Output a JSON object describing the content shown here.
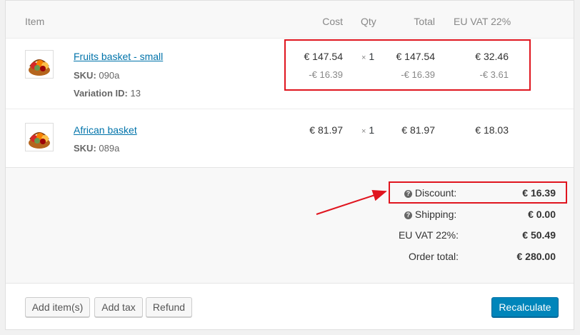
{
  "table": {
    "headers": {
      "item": "Item",
      "cost": "Cost",
      "qty": "Qty",
      "total": "Total",
      "tax": "EU VAT 22%"
    }
  },
  "items": [
    {
      "name": "Fruits basket - small",
      "sku_label": "SKU:",
      "sku": "090a",
      "variation_label": "Variation ID:",
      "variation": "13",
      "cost": "€ 147.54",
      "cost_discount": "-€ 16.39",
      "qty_sign": "×",
      "qty": "1",
      "total": "€ 147.54",
      "total_discount": "-€ 16.39",
      "tax": "€ 32.46",
      "tax_discount": "-€ 3.61",
      "thumb_icon": "fruit-basket-thumbnail"
    },
    {
      "name": "African basket",
      "sku_label": "SKU:",
      "sku": "089a",
      "cost": "€ 81.97",
      "qty_sign": "×",
      "qty": "1",
      "total": "€ 81.97",
      "tax": "€ 18.03",
      "thumb_icon": "fruit-basket-thumbnail"
    }
  ],
  "totals": {
    "discount_label": "Discount:",
    "discount": "€ 16.39",
    "shipping_label": "Shipping:",
    "shipping": "€ 0.00",
    "vat_label": "EU VAT 22%:",
    "vat": "€ 50.49",
    "order_total_label": "Order total:",
    "order_total": "€ 280.00",
    "help_icon": "question-circle-icon"
  },
  "actions": {
    "add_items": "Add item(s)",
    "add_tax": "Add tax",
    "refund": "Refund",
    "recalculate": "Recalculate"
  },
  "annotation": {
    "color": "#e0151f"
  },
  "colors": {
    "link": "#0073aa",
    "primary": "#0085ba"
  }
}
